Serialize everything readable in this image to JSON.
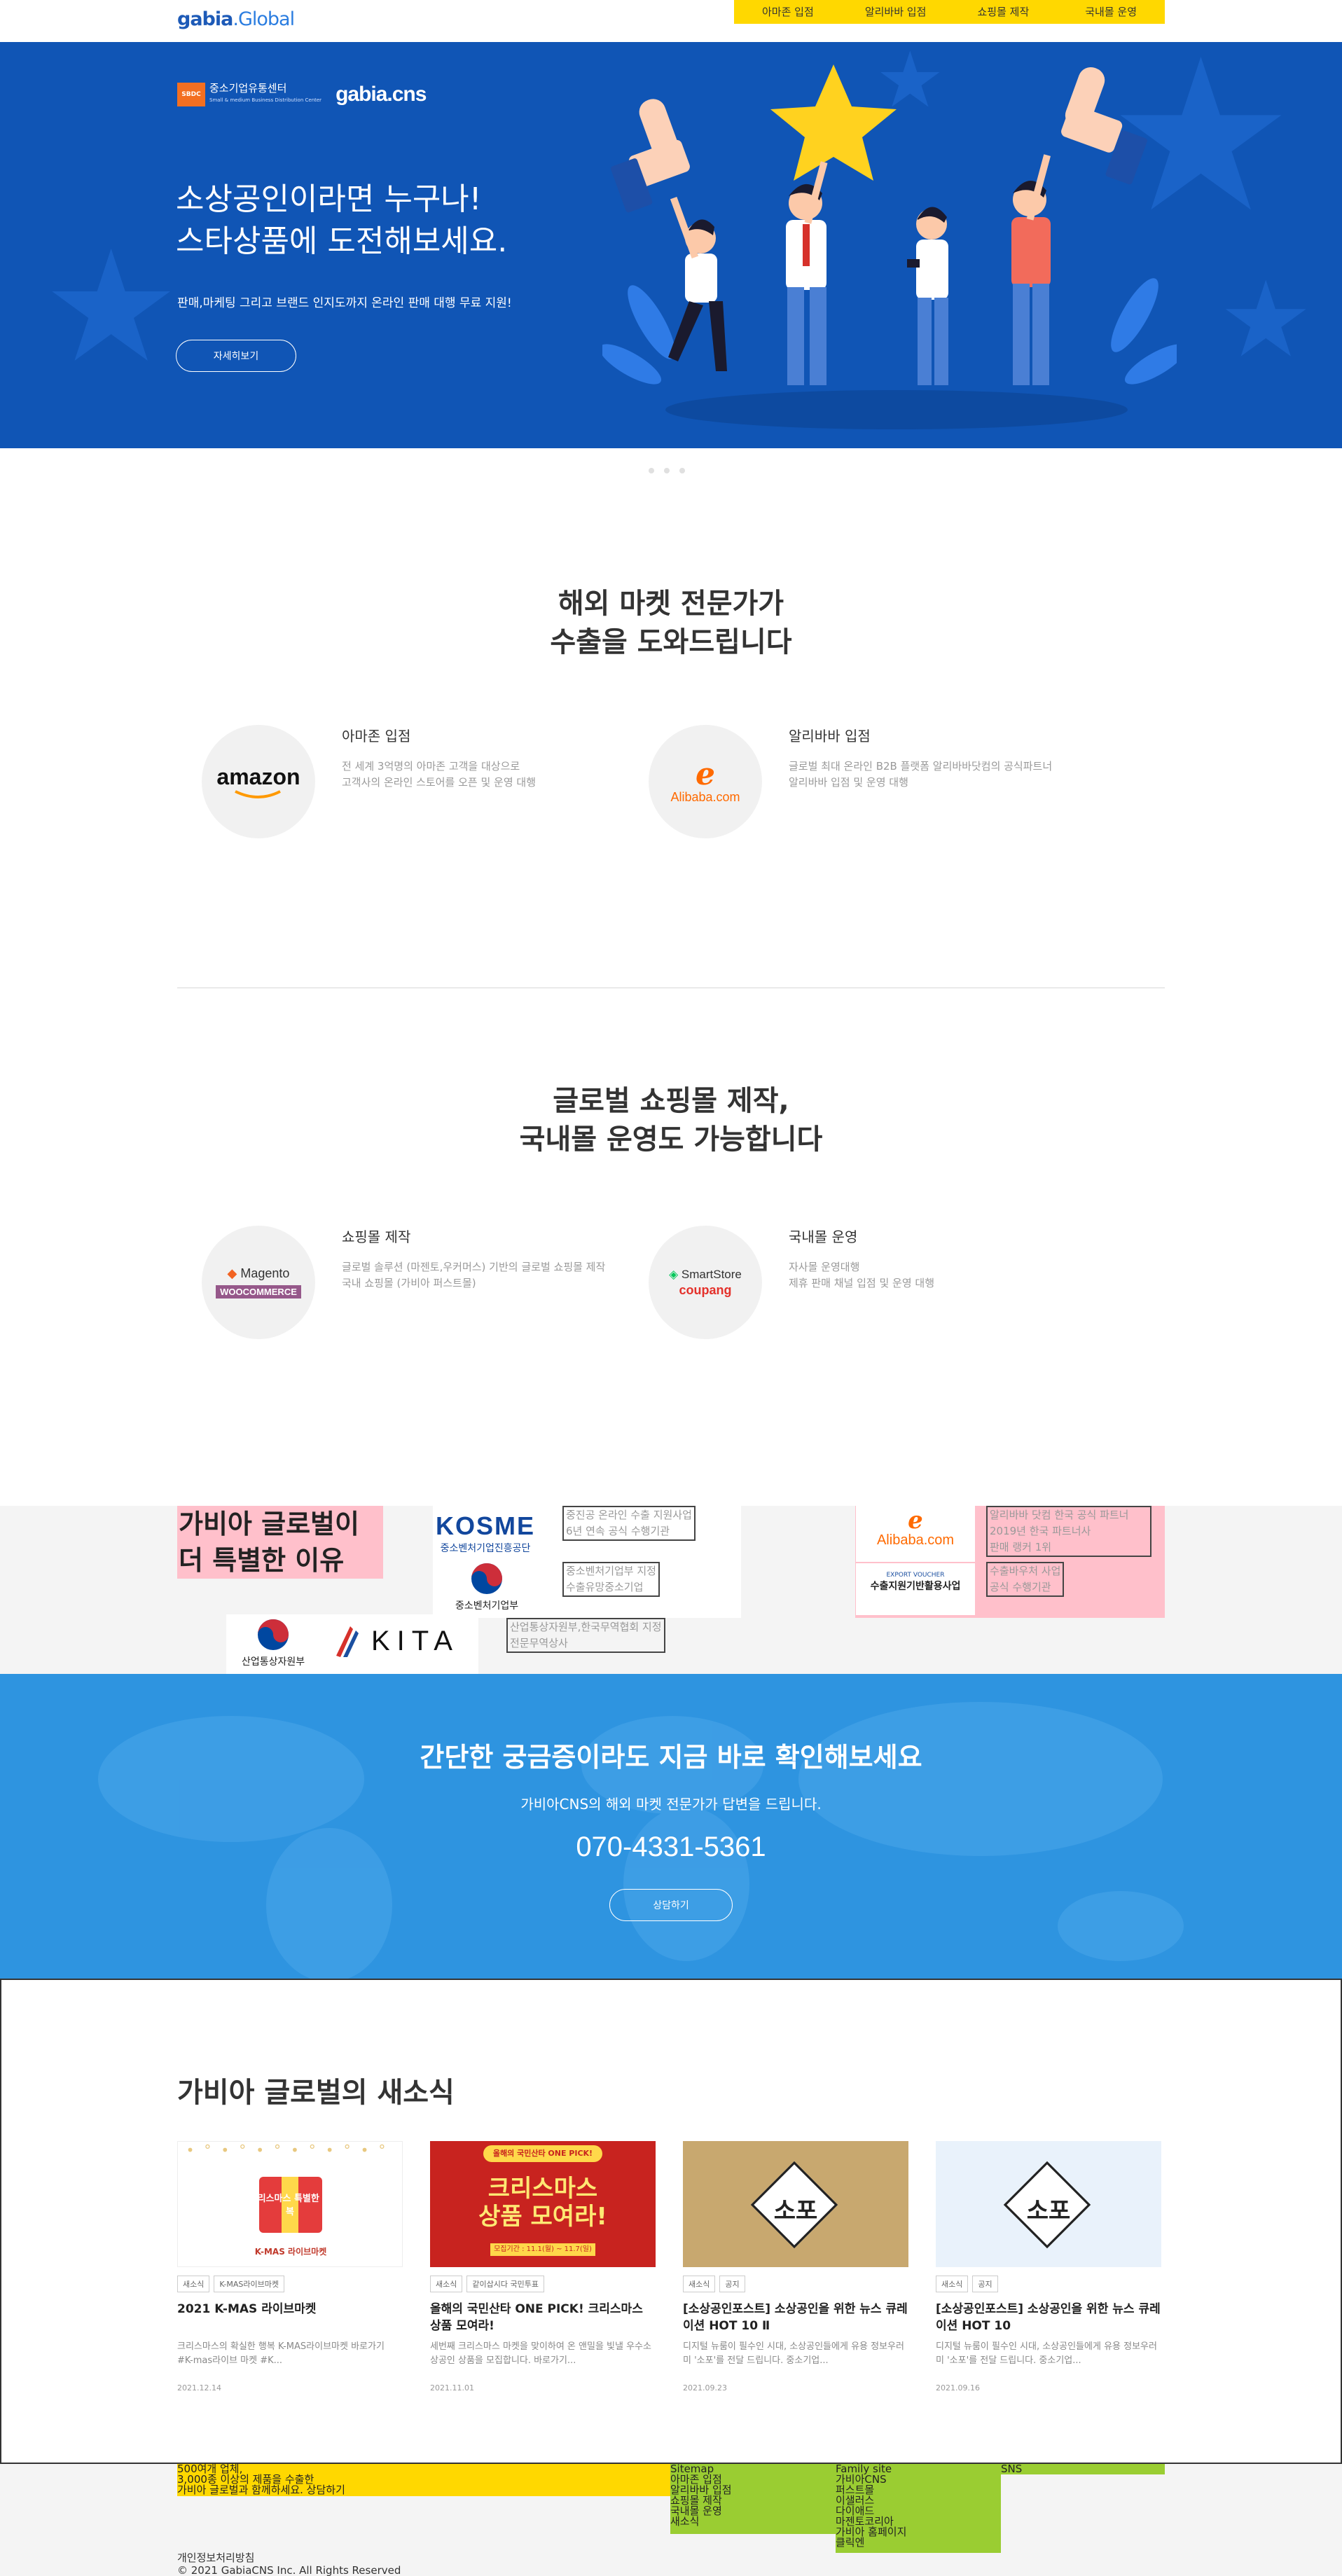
{
  "header": {
    "logo": "gabia",
    "logo_suffix": ".Global",
    "nav": [
      "아마존 입점",
      "알리바바 입점",
      "쇼핑몰 제작",
      "국내몰 운영"
    ]
  },
  "hero": {
    "sbdc_badge": "SBDC",
    "sbdc_name": "중소기업유통센터",
    "sbdc_sub": "Small & medium Business Distribution Center",
    "cns_logo": "gabia.cns",
    "title": "소상공인이라면 누구나!\n스타상품에 도전해보세요.",
    "subtitle": "판매,마케팅 그리고 브랜드 인지도까지 온라인 판매 대행 무료 지원!",
    "button": "자세히보기"
  },
  "section1": {
    "title": "해외 마켓 전문가가\n수출을 도와드립니다",
    "services": [
      {
        "name": "아마존 입점",
        "desc": "전 세계 3억명의 아마존 고객을 대상으로\n고객사의 온라인 스토어를 오픈 및 운영 대행",
        "logo": "amazon"
      },
      {
        "name": "알리바바 입점",
        "desc": "글로벌 최대 온라인 B2B 플랫폼 알리바바닷컴의 공식파트너\n알리바바 입점 및 운영 대행",
        "logo": "Alibaba.com"
      }
    ]
  },
  "section2": {
    "title": "글로벌 쇼핑몰 제작,\n국내몰 운영도 가능합니다",
    "services": [
      {
        "name": "쇼핑몰 제작",
        "desc": "글로벌 솔루션 (마젠토,우커머스) 기반의 글로벌 쇼핑몰 제작\n국내 쇼핑몰 (가비아 퍼스트몰)",
        "logo1": "Magento",
        "logo2": "WOOCOMMERCE"
      },
      {
        "name": "국내몰 운영",
        "desc": "자사몰 운영대행\n제휴 판매 채널 입점 및 운영 대행",
        "logo1": "SmartStore",
        "logo2": "coupang"
      }
    ]
  },
  "why": {
    "title": "가비아 글로벌이\n더 특별한 이유",
    "kosme_logo": "KOSME",
    "kosme_sub": "중소벤처기업진흥공단",
    "kosme_desc": "중진공 온라인 수출 지원사업\n6년 연속 공식 수행기관",
    "mss_logo": "중소벤처기업부",
    "mss_desc": "중소벤처기업부 지정\n수출유망중소기업",
    "motie_logo": "산업통상자원부",
    "kita_logo": "KITA",
    "kita_desc": "산업통상자원부,한국무역협회 지정\n전문무역상사",
    "alibaba_logo": "Alibaba.com",
    "alibaba_desc": "알리바바 닷컴 한국 공식 파트너\n2019년 한국 파트너사\n판매 랭커 1위",
    "voucher_tag": "EXPORT VOUCHER",
    "voucher_logo": "수출지원기반활용사업",
    "voucher_desc": "수출바우처 사업\n공식 수행기관"
  },
  "contact": {
    "title": "간단한 궁금증이라도 지금 바로 확인해보세요",
    "subtitle": "가비아CNS의 해외 마켓 전문가가 답변을 드립니다.",
    "phone": "070-4331-5361",
    "button": "상담하기"
  },
  "news": {
    "title": "가비아 글로벌의 새소식",
    "cards": [
      {
        "tags": [
          "새소식",
          "K-MAS라이브마켓"
        ],
        "title": "2021 K-MAS 라이브마켓",
        "desc": "크리스마스의 확실한 행복 K-MAS라이브마켓 바로가기 #K-mas라이브 마켓 #K...",
        "date": "2021.12.14",
        "thumb_text": "크리스마스 특별한 행복",
        "thumb_sub": "K-MAS 라이브마켓"
      },
      {
        "tags": [
          "새소식",
          "같이삽시다 국민투표"
        ],
        "title": "올해의 국민산타 ONE PICK! 크리스마스 상품 모여라!",
        "desc": "세번째 크리스마스 마켓을 맞이하여 온 앤밀을 빛낼 우수소상공인 상품을 모집합니다. 바로가기...",
        "date": "2021.11.01",
        "thumb_top": "올해의 국민산타 ONE PICK!",
        "thumb_text": "크리스마스\n상품 모여라!",
        "thumb_sub": "모집기간 : 11.1(월) ~ 11.7(일)"
      },
      {
        "tags": [
          "새소식",
          "공지"
        ],
        "title": "[소상공인포스트] 소상공인을 위한 뉴스 큐레이션 HOT 10 Ⅱ",
        "desc": "디지털 뉴룸이 필수인 시대, 소상공인들에게 유용 정보우러미 '소포'를 전달 드립니다. 중소기업...",
        "date": "2021.09.23",
        "thumb_text": "소포"
      },
      {
        "tags": [
          "새소식",
          "공지"
        ],
        "title": "[소상공인포스트] 소상공인을 위한 뉴스 큐레이션 HOT 10",
        "desc": "디지털 뉴룸이 필수인 시대, 소상공인들에게 유용 정보우러미 '소포'를 전달 드립니다. 중소기업...",
        "date": "2021.09.16",
        "thumb_text": "소포"
      }
    ]
  },
  "footer": {
    "promo": "500여개 업체,\n3,000종 이상의 제품을 수출한\n가비아 글로벌과 함께하세요. 상담하기",
    "sitemap_title": "Sitemap",
    "sitemap_items": [
      "아마존 입점",
      "알리바바 입점",
      "쇼핑몰 제작",
      "국내몰 운영",
      "새소식"
    ],
    "family_title": "Family site",
    "family_items": [
      "가비아CNS",
      "퍼스트몰",
      "이샐러스",
      "다이애드",
      "마젠토코리아",
      "가비아 홈페이지",
      "클릭엔"
    ],
    "sns_title": "SNS",
    "privacy": "개인정보처리방침",
    "copyright": "© 2021 GabiaCNS Inc. All Rights Reserved"
  },
  "colors": {
    "accent_yellow": "#ffd800",
    "hero_blue": "#1055b5",
    "contact_blue": "#2e94e0",
    "debug_pink": "#ffc0cb",
    "footer_green": "#9acd32"
  }
}
